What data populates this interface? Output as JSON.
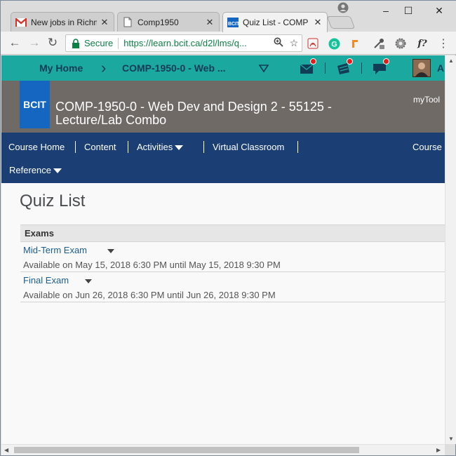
{
  "browser": {
    "tabs": [
      {
        "label": "New jobs in Richm",
        "icon": "gmail-icon",
        "close": "✕"
      },
      {
        "label": "Comp1950",
        "icon": "page-icon",
        "close": "✕"
      },
      {
        "label": "Quiz List - COMP",
        "icon": "bcit-favicon",
        "close": "✕"
      }
    ],
    "window_controls": {
      "minimize": "–",
      "maximize": "☐",
      "close": "✕"
    },
    "nav": {
      "back": "←",
      "forward": "→",
      "reload": "↻"
    },
    "address": {
      "secure_label": "Secure",
      "url": "https://learn.bcit.ca/d2l/lms/q..."
    },
    "extension_f": "f?"
  },
  "site": {
    "my_home": "My Home",
    "course_crumb": "COMP-1950-0 - Web ...",
    "avatar_initial": "A",
    "logo_text": "BCIT",
    "course_title": "COMP-1950-0 - Web Dev and Design 2 - 55125 - Lecture/Lab Combo",
    "my_tools": "myTool",
    "nav": {
      "course_home": "Course Home",
      "content": "Content",
      "activities": "Activities",
      "virtual_classroom": "Virtual Classroom",
      "course": "Course",
      "reference": "Reference"
    }
  },
  "quiz_list": {
    "title": "Quiz List",
    "section": "Exams",
    "quizzes": [
      {
        "name": "Mid-Term Exam",
        "availability": "Available on May 15, 2018 6:30 PM until May 15, 2018 9:30 PM"
      },
      {
        "name": "Final Exam",
        "availability": "Available on Jun 26, 2018 6:30 PM until Jun 26, 2018 9:30 PM"
      }
    ]
  },
  "colors": {
    "topnav": "#1ba89f",
    "banner": "#6f6a66",
    "course_nav": "#1b3f74",
    "logo": "#1566c0",
    "link": "#1a5e90"
  }
}
